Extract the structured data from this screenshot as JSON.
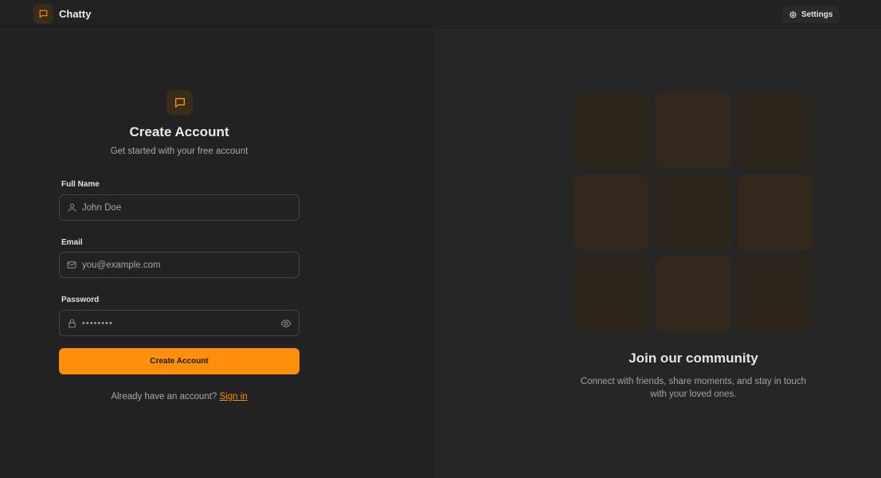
{
  "navbar": {
    "brand_name": "Chatty",
    "settings_label": "Settings"
  },
  "form": {
    "title": "Create Account",
    "subtitle": "Get started with your free account",
    "fields": [
      {
        "label": "Full Name",
        "placeholder": "John Doe",
        "icon": "user-icon"
      },
      {
        "label": "Email",
        "placeholder": "you@example.com",
        "icon": "mail-icon"
      },
      {
        "label": "Password",
        "placeholder": "••••••••",
        "icon": "lock-icon"
      }
    ],
    "submit_label": "Create Account",
    "signin_prompt": "Already have an account?",
    "signin_link": "Sign in"
  },
  "promo": {
    "tiles": [
      {
        "color": "#2d261c"
      },
      {
        "color": "#33281b"
      },
      {
        "color": "#2d261c"
      },
      {
        "color": "#33281b"
      },
      {
        "color": "#2d261c"
      },
      {
        "color": "#33281b"
      },
      {
        "color": "#2d261c"
      },
      {
        "color": "#33281b"
      },
      {
        "color": "#2d261c"
      }
    ],
    "title": "Join our community",
    "text": "Connect with friends, share moments, and stay in touch with your loved ones."
  },
  "colors": {
    "accent": "#fe8f0b",
    "background": "#222222"
  }
}
